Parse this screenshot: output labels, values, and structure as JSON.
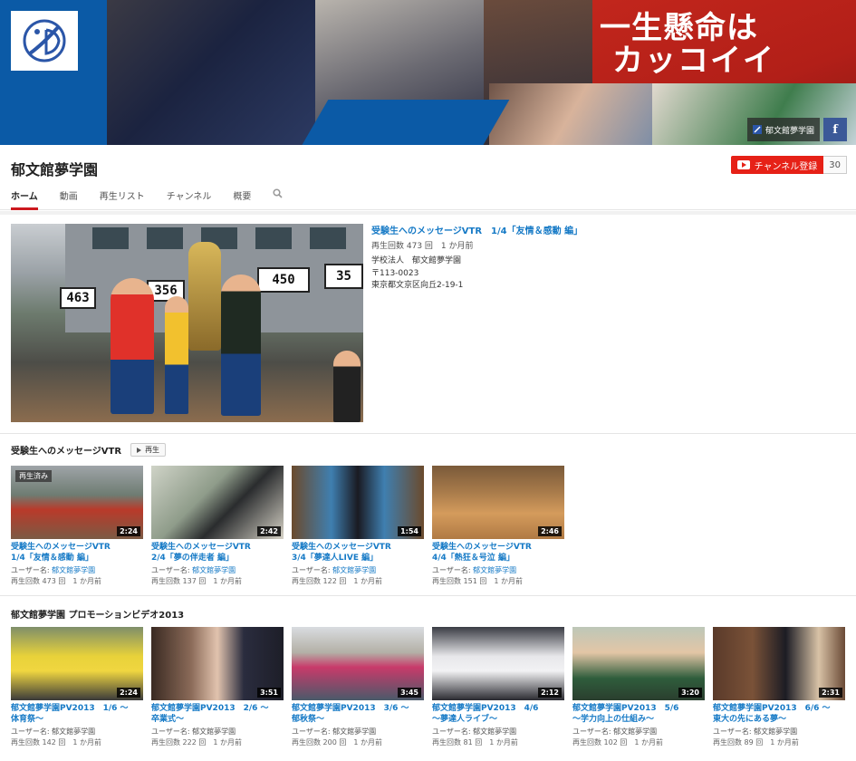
{
  "banner": {
    "slogan_line1": "一生懸命は",
    "slogan_line2": "カッコイイ",
    "link_label": "郁文館夢学園",
    "facebook_label": "f"
  },
  "channel": {
    "title": "郁文館夢学園",
    "subscribe_label": "チャンネル登録",
    "subscriber_count": "30",
    "tabs": [
      "ホーム",
      "動画",
      "再生リスト",
      "チャンネル",
      "概要"
    ]
  },
  "featured": {
    "title": "受験生へのメッセージVTR　1/4「友情＆感動 編」",
    "meta": "再生回数 473 回　1 か月前",
    "desc_line1": "学校法人　郁文館夢学園",
    "desc_line2": "〒113-0023",
    "desc_line3": "東京都文京区向丘2-19-1",
    "scores": [
      "463",
      "356",
      "450",
      "35"
    ]
  },
  "shelf1": {
    "title": "受験生へのメッセージVTR",
    "play_label": "再生",
    "videos": [
      {
        "title_line1": "受験生へのメッセージVTR",
        "title_line2": "1/4「友情＆感動 編」",
        "user_label": "ユーザー名: ",
        "user": "郁文館夢学園",
        "stats": "再生回数 473 回　1 か月前",
        "duration": "2:24",
        "watched": "再生済み"
      },
      {
        "title_line1": "受験生へのメッセージVTR",
        "title_line2": "2/4「夢の伴走者 編」",
        "user_label": "ユーザー名: ",
        "user": "郁文館夢学園",
        "stats": "再生回数 137 回　1 か月前",
        "duration": "2:42"
      },
      {
        "title_line1": "受験生へのメッセージVTR",
        "title_line2": "3/4「夢達人LIVE 編」",
        "user_label": "ユーザー名: ",
        "user": "郁文館夢学園",
        "stats": "再生回数 122 回　1 か月前",
        "duration": "1:54"
      },
      {
        "title_line1": "受験生へのメッセージVTR",
        "title_line2": "4/4「熱狂＆号泣 編」",
        "user_label": "ユーザー名: ",
        "user": "郁文館夢学園",
        "stats": "再生回数 151 回　1 か月前",
        "duration": "2:46"
      }
    ]
  },
  "shelf2": {
    "title": "郁文館夢学園 プロモーションビデオ2013",
    "videos": [
      {
        "title_line1": "郁文館夢学園PV2013　1/6 ～",
        "title_line2": "体育祭～",
        "user_label": "ユーザー名: ",
        "user": "郁文館夢学園",
        "stats": "再生回数 142 回　1 か月前",
        "duration": "2:24"
      },
      {
        "title_line1": "郁文館夢学園PV2013　2/6 ～",
        "title_line2": "卒業式～",
        "user_label": "ユーザー名: ",
        "user": "郁文館夢学園",
        "stats": "再生回数 222 回　1 か月前",
        "duration": "3:51"
      },
      {
        "title_line1": "郁文館夢学園PV2013　3/6 ～",
        "title_line2": "郁秋祭～",
        "user_label": "ユーザー名: ",
        "user": "郁文館夢学園",
        "stats": "再生回数 200 回　1 か月前",
        "duration": "3:45"
      },
      {
        "title_line1": "郁文館夢学園PV2013　4/6",
        "title_line2": "～夢達人ライブ～",
        "user_label": "ユーザー名: ",
        "user": "郁文館夢学園",
        "stats": "再生回数 81 回　1 か月前",
        "duration": "2:12"
      },
      {
        "title_line1": "郁文館夢学園PV2013　5/6",
        "title_line2": "～学力向上の仕組み～",
        "user_label": "ユーザー名: ",
        "user": "郁文館夢学園",
        "stats": "再生回数 102 回　1 か月前",
        "duration": "3:20"
      },
      {
        "title_line1": "郁文館夢学園PV2013　6/6 ～",
        "title_line2": "東大の先にある夢～",
        "user_label": "ユーザー名: ",
        "user": "郁文館夢学園",
        "stats": "再生回数 89 回　1 か月前",
        "duration": "2:31"
      }
    ]
  },
  "colors": {
    "accent_red": "#e62117",
    "link_blue": "#167ac6",
    "brand_blue": "#0b5aa6"
  }
}
